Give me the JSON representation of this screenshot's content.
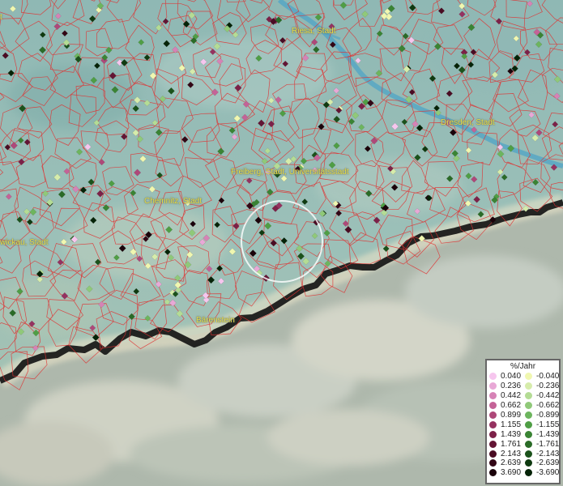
{
  "map": {
    "cities": [
      {
        "name": "Riesa, Stadt"
      },
      {
        "name": "Dresden, Stadt"
      },
      {
        "name": "Freiberg, Stadt, Universitätsstadt"
      },
      {
        "name": "Chemnitz, Stadt"
      },
      {
        "name": "wickau, Stadt"
      },
      {
        "name": "Bärenstein"
      },
      {
        "name": "t"
      }
    ]
  },
  "legend": {
    "title": "%/Jahr",
    "positive": [
      {
        "value": "0.040",
        "color": "#f6c6ee"
      },
      {
        "value": "0.236",
        "color": "#e8a8d6"
      },
      {
        "value": "0.442",
        "color": "#d683b6"
      },
      {
        "value": "0.662",
        "color": "#c46397"
      },
      {
        "value": "0.899",
        "color": "#ae4879"
      },
      {
        "value": "1.155",
        "color": "#953260"
      },
      {
        "value": "1.439",
        "color": "#7c2148"
      },
      {
        "value": "1.761",
        "color": "#631534"
      },
      {
        "value": "2.143",
        "color": "#4a0c23"
      },
      {
        "value": "2.639",
        "color": "#320615"
      },
      {
        "value": "3.690",
        "color": "#1a020a"
      }
    ],
    "negative": [
      {
        "value": "-0.040",
        "color": "#f0f7b0"
      },
      {
        "value": "-0.236",
        "color": "#d6ecab"
      },
      {
        "value": "-0.442",
        "color": "#b4dc95"
      },
      {
        "value": "-0.662",
        "color": "#90c979"
      },
      {
        "value": "-0.899",
        "color": "#6db55e"
      },
      {
        "value": "-1.155",
        "color": "#4f9e45"
      },
      {
        "value": "-1.439",
        "color": "#3a8434"
      },
      {
        "value": "-1.761",
        "color": "#2a6b27"
      },
      {
        "value": "-2.143",
        "color": "#1b521b"
      },
      {
        "value": "-2.639",
        "color": "#0f3a10"
      },
      {
        "value": "-3.690",
        "color": "#052307"
      }
    ]
  }
}
